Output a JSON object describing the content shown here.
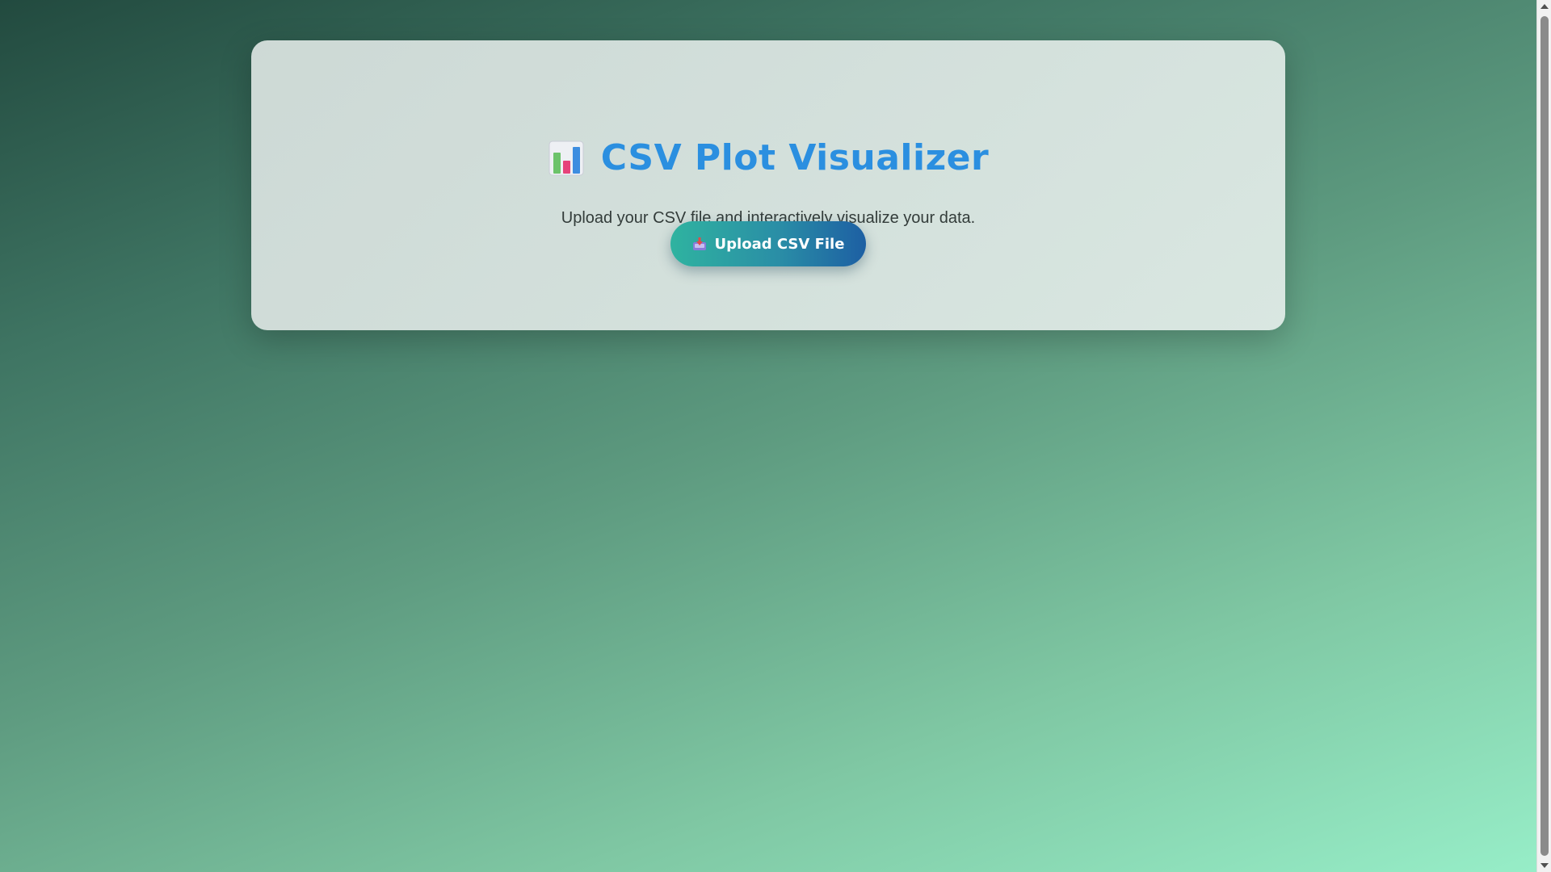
{
  "app": {
    "title": "CSV Plot Visualizer",
    "subtitle": "Upload your CSV file and interactively visualize your data."
  },
  "upload": {
    "label": "Upload CSV File",
    "icon": "inbox-tray-icon"
  },
  "icons": {
    "title_icon": "bar-chart-icon"
  },
  "colors": {
    "title": "#2b8fe0",
    "button_gradient_start": "#2fb3a0",
    "button_gradient_end": "#1d5fa3",
    "background_start": "#224a3f",
    "background_end": "#97eec8"
  }
}
